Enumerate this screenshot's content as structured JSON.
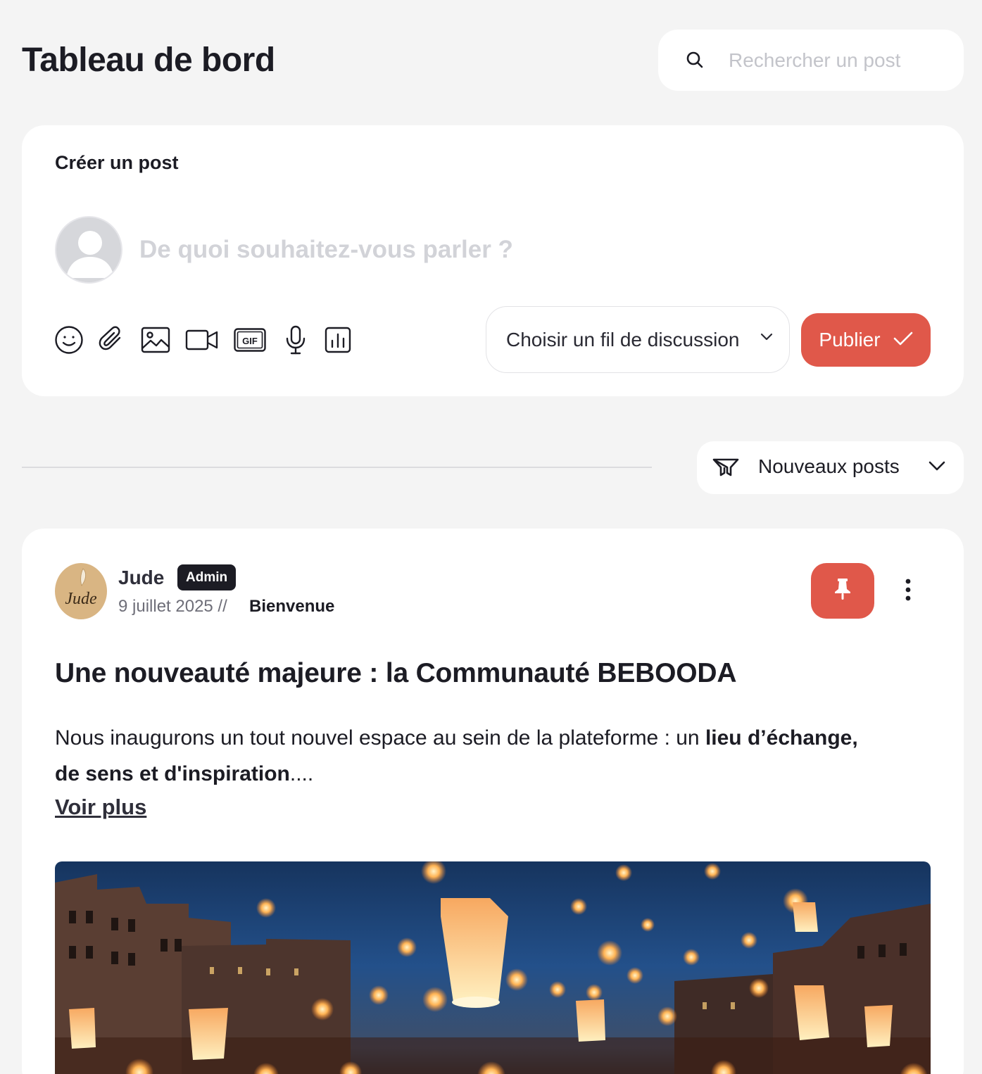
{
  "header": {
    "title": "Tableau de bord",
    "search_placeholder": "Rechercher un post"
  },
  "composer": {
    "title": "Créer un post",
    "placeholder": "De quoi souhaitez-vous parler ?",
    "tools": [
      "emoji-icon",
      "paperclip-icon",
      "image-icon",
      "video-icon",
      "gif-icon",
      "microphone-icon",
      "poll-icon"
    ],
    "gif_label": "GIF",
    "thread_select_label": "Choisir un fil de discussion",
    "publish_label": "Publier"
  },
  "feed": {
    "sort_label": "Nouveaux posts"
  },
  "post": {
    "author": "Jude",
    "avatar_text": "Jude",
    "badge": "Admin",
    "date": "9 juillet 2025 //",
    "thread": "Bienvenue",
    "title": "Une nouveauté majeure : la Communauté BEBOODA",
    "body_start": "Nous inaugurons un tout nouvel espace au sein de la plateforme : un ",
    "body_bold": "lieu d’échange, de sens et d'inspiration",
    "body_end": "....",
    "read_more": "Voir plus"
  },
  "colors": {
    "accent": "#e0584a",
    "background": "#f4f4f4",
    "card": "#ffffff",
    "text": "#1c1c24",
    "badge_bg": "#1c1c24"
  }
}
